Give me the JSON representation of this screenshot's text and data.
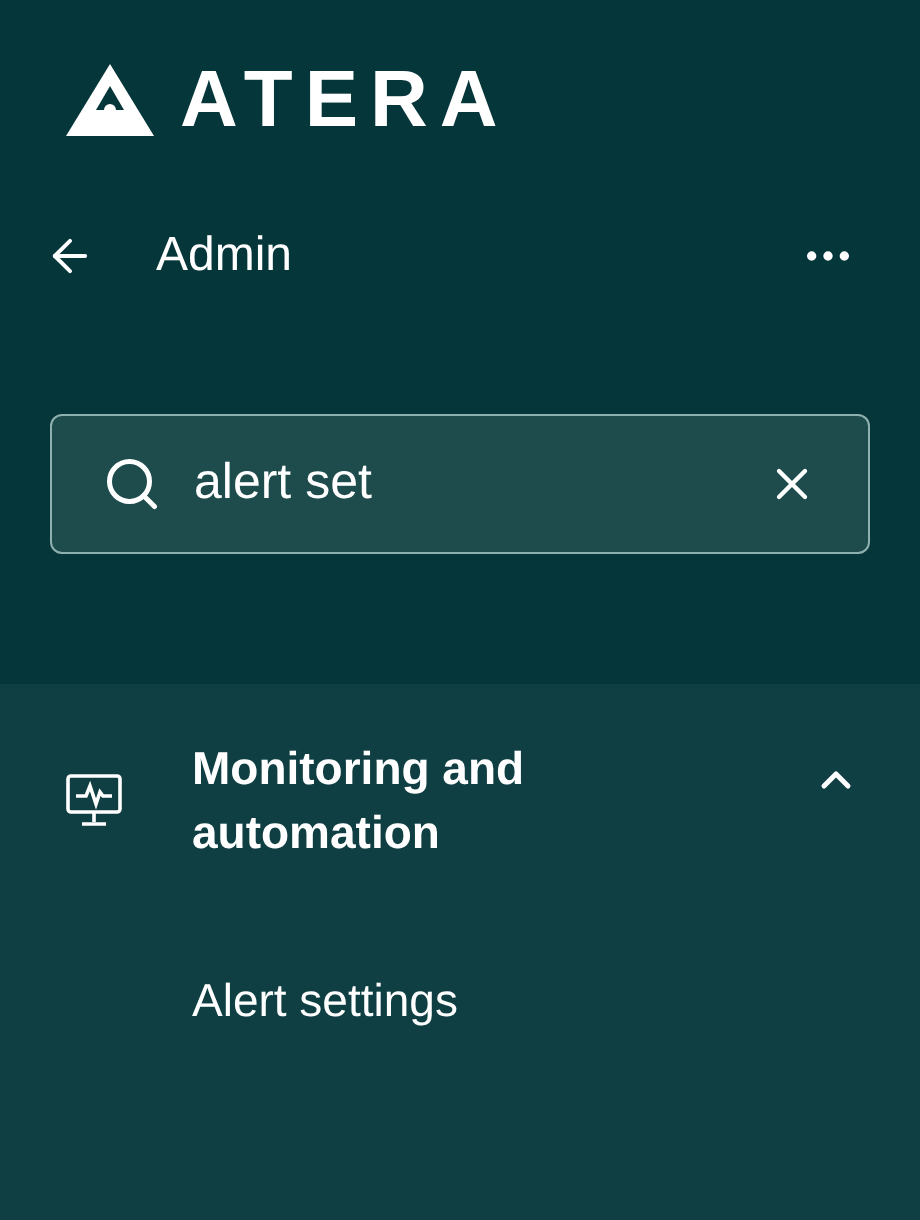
{
  "logo": {
    "text": "ATERA"
  },
  "header": {
    "title": "Admin"
  },
  "search": {
    "value": "alert set"
  },
  "groups": [
    {
      "label": "Monitoring and automation",
      "expanded": true,
      "items": [
        {
          "label": "Alert settings"
        }
      ]
    }
  ]
}
